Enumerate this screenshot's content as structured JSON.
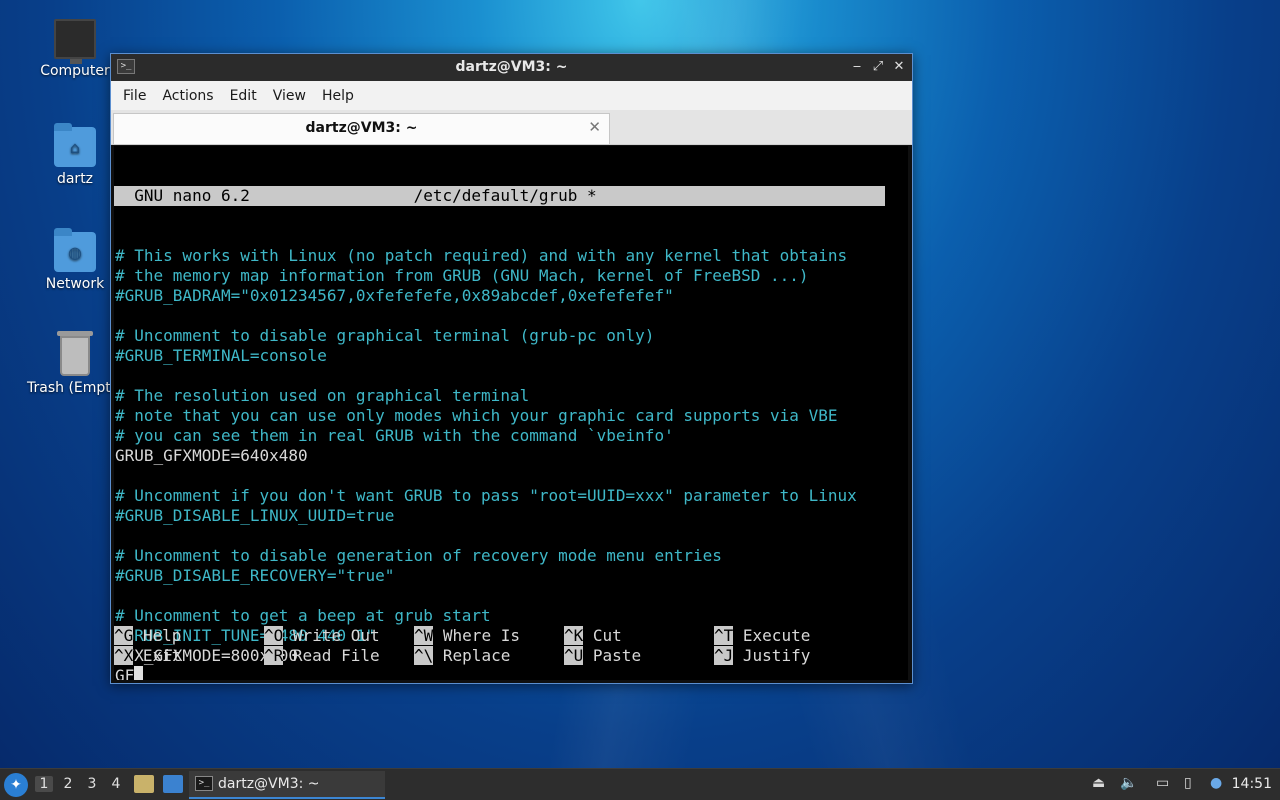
{
  "desktop": {
    "icons": [
      {
        "label": "Computer",
        "icon": "monitor-icon"
      },
      {
        "label": "dartz",
        "icon": "home-folder-icon"
      },
      {
        "label": "Network",
        "icon": "network-folder-icon"
      },
      {
        "label": "Trash (Empty)",
        "icon": "trash-icon"
      }
    ]
  },
  "window": {
    "title": "dartz@VM3: ~",
    "buttons": {
      "minimize": "‒",
      "maximize": "⤢",
      "close": "✕"
    },
    "menu": [
      "File",
      "Actions",
      "Edit",
      "View",
      "Help"
    ],
    "tab": {
      "label": "dartz@VM3: ~",
      "close": "✕"
    }
  },
  "nano": {
    "header": "  GNU nano 6.2                 /etc/default/grub *",
    "lines": [
      {
        "text": "# This works with Linux (no patch required) and with any kernel that obtains",
        "type": "comment"
      },
      {
        "text": "# the memory map information from GRUB (GNU Mach, kernel of FreeBSD ...)",
        "type": "comment"
      },
      {
        "text": "#GRUB_BADRAM=\"0x01234567,0xfefefefe,0x89abcdef,0xefefefef\"",
        "type": "comment"
      },
      {
        "text": "",
        "type": "plain"
      },
      {
        "text": "# Uncomment to disable graphical terminal (grub-pc only)",
        "type": "comment"
      },
      {
        "text": "#GRUB_TERMINAL=console",
        "type": "comment"
      },
      {
        "text": "",
        "type": "plain"
      },
      {
        "text": "# The resolution used on graphical terminal",
        "type": "comment"
      },
      {
        "text": "# note that you can use only modes which your graphic card supports via VBE",
        "type": "comment"
      },
      {
        "text": "# you can see them in real GRUB with the command `vbeinfo'",
        "type": "comment"
      },
      {
        "text": "GRUB_GFXMODE=640x480",
        "type": "plain"
      },
      {
        "text": "",
        "type": "plain"
      },
      {
        "text": "# Uncomment if you don't want GRUB to pass \"root=UUID=xxx\" parameter to Linux",
        "type": "comment"
      },
      {
        "text": "#GRUB_DISABLE_LINUX_UUID=true",
        "type": "comment"
      },
      {
        "text": "",
        "type": "plain"
      },
      {
        "text": "# Uncomment to disable generation of recovery mode menu entries",
        "type": "comment"
      },
      {
        "text": "#GRUB_DISABLE_RECOVERY=\"true\"",
        "type": "comment"
      },
      {
        "text": "",
        "type": "plain"
      },
      {
        "text": "# Uncomment to get a beep at grub start",
        "type": "comment"
      },
      {
        "text": "#GRUB_INIT_TUNE=\"480 440 1\"",
        "type": "comment"
      },
      {
        "text": "GFX_GFXMODE=800x600",
        "type": "plain"
      },
      {
        "text": "GF",
        "type": "plain",
        "cursor": true
      }
    ],
    "shortcuts": [
      [
        {
          "key": "^G",
          "label": "Help"
        },
        {
          "key": "^O",
          "label": "Write Out"
        },
        {
          "key": "^W",
          "label": "Where Is"
        },
        {
          "key": "^K",
          "label": "Cut"
        },
        {
          "key": "^T",
          "label": "Execute"
        }
      ],
      [
        {
          "key": "^X",
          "label": "Exit"
        },
        {
          "key": "^R",
          "label": "Read File"
        },
        {
          "key": "^\\",
          "label": "Replace"
        },
        {
          "key": "^U",
          "label": "Paste"
        },
        {
          "key": "^J",
          "label": "Justify"
        }
      ]
    ]
  },
  "taskbar": {
    "workspaces": [
      "1",
      "2",
      "3",
      "4"
    ],
    "active_workspace": "1",
    "task_label": "dartz@VM3: ~",
    "clock": "14:51"
  }
}
